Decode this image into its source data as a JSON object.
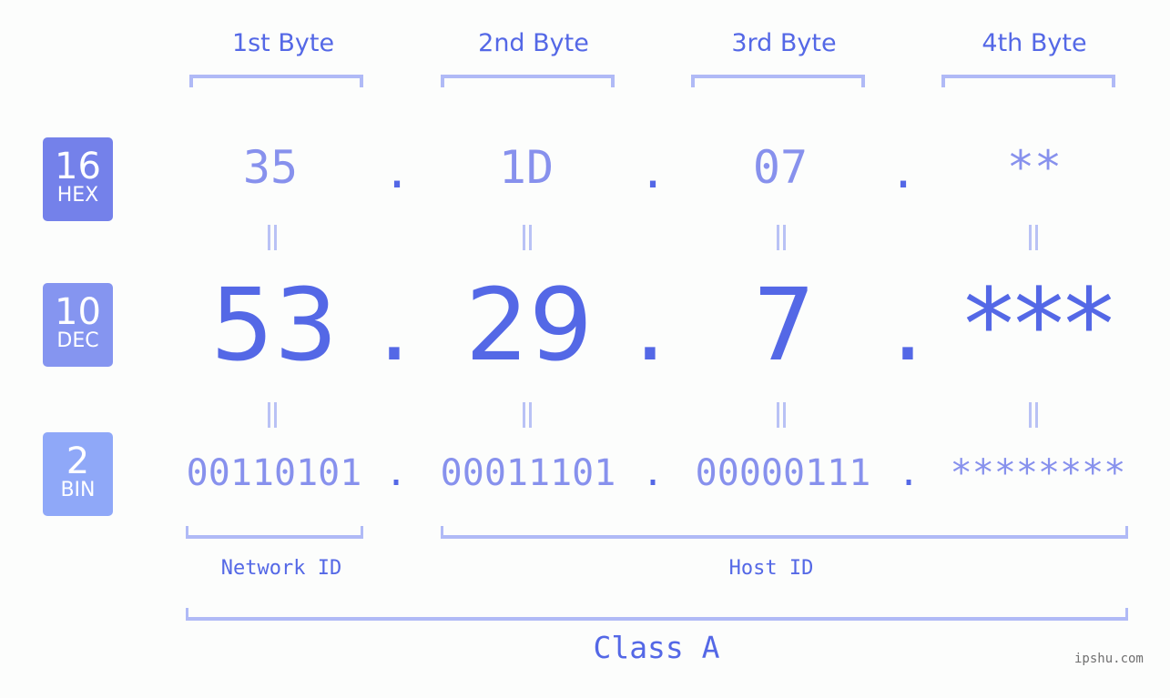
{
  "badges": [
    {
      "num": "16",
      "label": "HEX",
      "color": "#7481ea"
    },
    {
      "num": "10",
      "label": "DEC",
      "color": "#8595f0"
    },
    {
      "num": "2",
      "label": "BIN",
      "color": "#8fa8f8"
    }
  ],
  "bytes": [
    {
      "label": "1st Byte",
      "hex": "35",
      "dec": "53",
      "bin": "00110101"
    },
    {
      "label": "2nd Byte",
      "hex": "1D",
      "dec": "29",
      "bin": "00011101"
    },
    {
      "label": "3rd Byte",
      "hex": "07",
      "dec": "7",
      "bin": "00000111"
    },
    {
      "label": "4th Byte",
      "hex": "**",
      "dec": "***",
      "bin": "********"
    }
  ],
  "separator": ".",
  "network_label": "Network ID",
  "host_label": "Host ID",
  "class_label": "Class A",
  "watermark": "ipshu.com",
  "colors": {
    "primary": "#5468e6",
    "secondary": "#8791ed",
    "bracket": "#b0baf6"
  }
}
